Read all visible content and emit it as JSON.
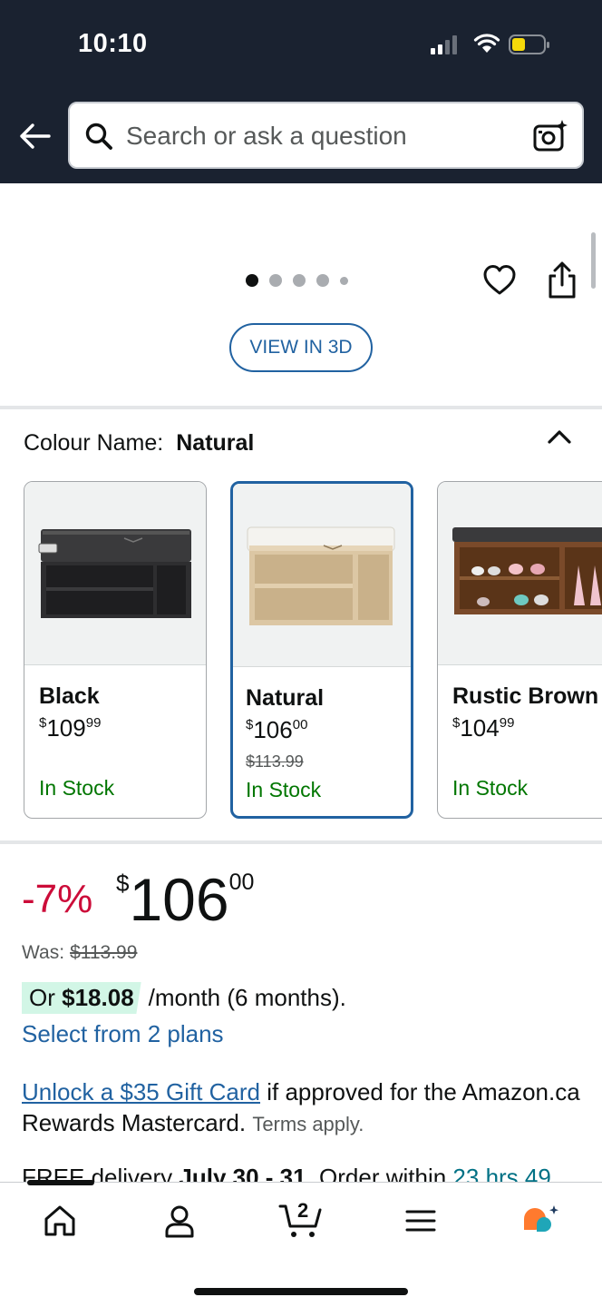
{
  "status_bar": {
    "time": "10:10"
  },
  "header": {
    "search_placeholder": "Search or ask a question"
  },
  "gallery": {
    "dot_count": 5,
    "active_dot": 1,
    "view_3d_label": "VIEW IN 3D"
  },
  "colour": {
    "label": "Colour Name:",
    "selected": "Natural",
    "options": [
      {
        "name": "Black",
        "price_symbol": "$",
        "price_whole": "109",
        "price_cents": "99",
        "was": "",
        "stock": "In Stock"
      },
      {
        "name": "Natural",
        "price_symbol": "$",
        "price_whole": "106",
        "price_cents": "00",
        "was": "$113.99",
        "stock": "In Stock"
      },
      {
        "name": "Rustic Brown",
        "price_symbol": "$",
        "price_whole": "104",
        "price_cents": "99",
        "was": "",
        "stock": "In Stock"
      }
    ]
  },
  "pricing": {
    "discount": "-7%",
    "currency": "$",
    "whole": "106",
    "cents": "00",
    "was_label": "Was:",
    "was_price": "$113.99",
    "monthly_prefix": "Or",
    "monthly_amount": "$18.08",
    "monthly_suffix": "/month (6 months).",
    "plans_link": "Select from 2 plans"
  },
  "promo": {
    "link_text": "Unlock a $35 Gift Card",
    "text": " if approved for the Amazon.ca Rewards Mastercard.",
    "terms": "Terms apply."
  },
  "delivery": {
    "prefix": "FREE delivery ",
    "dates": "July 30 - 31",
    "middle": ". Order within ",
    "countdown": "23 hrs 49"
  },
  "colors": {
    "header_bg": "#1a2230",
    "link": "#2162a1",
    "discount": "#cc0c39",
    "in_stock": "#007600",
    "highlight": "#d2f6e6"
  },
  "bottom_nav": {
    "items": [
      "home-icon",
      "account-icon",
      "cart-icon",
      "menu-icon",
      "rufus-assistant-icon"
    ],
    "cart_count": "2"
  }
}
